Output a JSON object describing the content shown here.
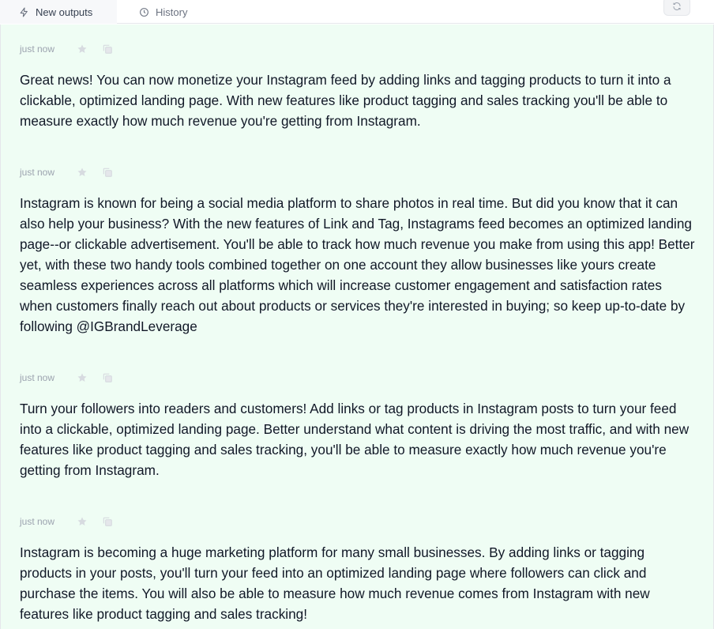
{
  "tabs": {
    "new_outputs": "New outputs",
    "history": "History"
  },
  "outputs": [
    {
      "time": "just now",
      "text": "Great news! You can now monetize your Instagram feed by adding links and tagging products to turn it into a clickable, optimized landing page. With new features like product tagging and sales tracking you'll be able to measure exactly how much revenue you're getting from Instagram."
    },
    {
      "time": "just now",
      "text": "Instagram is known for being a social media platform to share photos in real time. But did you know that it can also help your business? With the new features of Link and Tag, Instagrams feed becomes an optimized landing page--or clickable advertisement. You'll be able to track how much revenue you make from using this app! Better yet, with these two handy tools combined together on one account they allow businesses like yours create seamless experiences across all platforms which will increase customer engagement and satisfaction rates when customers finally reach out about products or services they're interested in buying; so keep up-to-date by following @IGBrandLeverage"
    },
    {
      "time": "just now",
      "text": "Turn your followers into readers and customers! Add links or tag products in Instagram posts to turn your feed into a clickable, optimized landing page. Better understand what content is driving the most traffic, and with new features like product tagging and sales tracking, you'll be able to measure exactly how much revenue you're getting from Instagram."
    },
    {
      "time": "just now",
      "text": "Instagram is becoming a huge marketing platform for many small businesses. By adding links or tagging products in your posts, you'll turn your feed into an optimized landing page where followers can click and purchase the items. You will also be able to measure how much revenue comes from Instagram with new features like product tagging and sales tracking!"
    }
  ],
  "icons": {
    "new_outputs": "lightning-icon",
    "history": "clock-icon",
    "refresh": "refresh-icon",
    "favorite": "star-icon",
    "copy": "copy-icon"
  },
  "colors": {
    "content_background": "#effdf4",
    "meta_text": "#9ca3af",
    "body_text": "#111827"
  }
}
